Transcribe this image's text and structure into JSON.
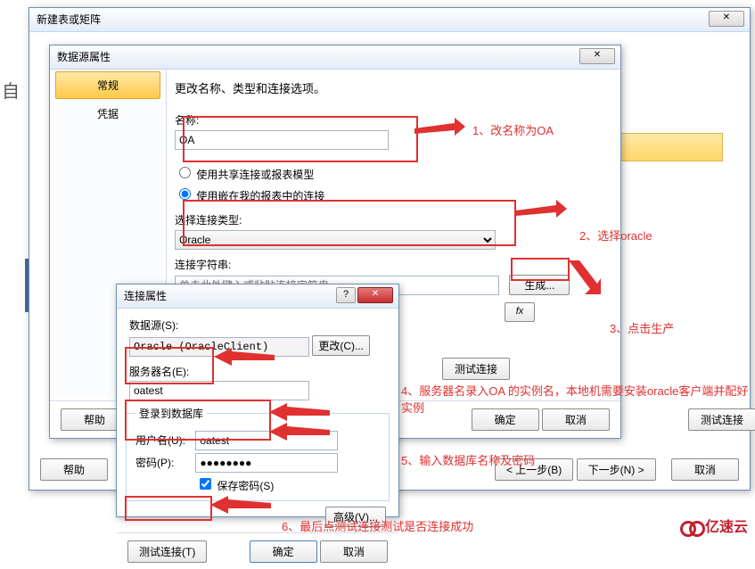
{
  "win1": {
    "title": "新建表或矩阵",
    "help": "帮助",
    "prev": "< 上一步(B)",
    "next": "下一步(N) >",
    "cancel": "取消"
  },
  "win2": {
    "title": "数据源属性",
    "sidebar": {
      "general": "常规",
      "credentials": "凭据"
    },
    "heading": "更改名称、类型和连接选项。",
    "name_label": "名称:",
    "name_value": "OA",
    "radio_shared": "使用共享连接或报表模型",
    "radio_embedded": "使用嵌在我的报表中的连接",
    "conn_type_label": "选择连接类型:",
    "conn_type_value": "Oracle",
    "conn_str_label": "连接字符串:",
    "conn_str_placeholder": "单击此处键入或粘贴连接字符串",
    "build": "生成...",
    "fx": "fx",
    "test": "测试连接",
    "help": "帮助",
    "ok": "确定",
    "cancel": "取消",
    "test2": "测试连接"
  },
  "win3": {
    "title": "连接属性",
    "ds_label": "数据源(S):",
    "ds_value": "Oracle (OracleClient)",
    "change": "更改(C)...",
    "server_label": "服务器名(E):",
    "server_value": "oatest",
    "login_group": "登录到数据库",
    "user_label": "用户名(U):",
    "user_value": "oatest",
    "pwd_label": "密码(P):",
    "pwd_value": "●●●●●●●●",
    "save_pwd": "保存密码(S)",
    "advanced": "高级(V)...",
    "test": "测试连接(T)",
    "ok": "确定",
    "cancel": "取消"
  },
  "ann": {
    "a1": "1、改名称为OA",
    "a2": "2、选择oracle",
    "a3": "3、点击生产",
    "a4": "4、服务器名录入OA 的实例名，本地机需要安装oracle客户端并配好实例",
    "a5": "5、输入数据库名称及密码",
    "a6": "6、最后点测试连接测试是否连接成功"
  },
  "logo": "亿速云",
  "sideword": "自"
}
